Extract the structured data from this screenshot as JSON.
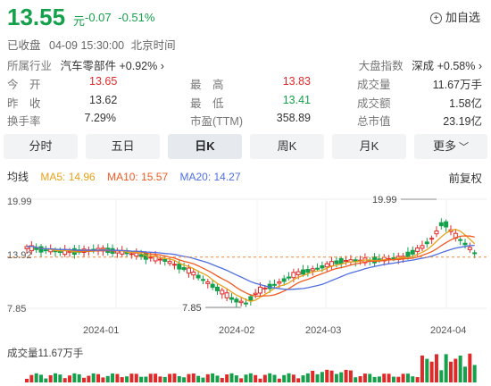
{
  "header": {
    "price": "13.55",
    "unit": "元",
    "change": "-0.07",
    "change_pct": "-0.51%",
    "add_label": "加自选"
  },
  "status": {
    "text": "已收盘",
    "datetime": "04-09 15:30:00",
    "tz": "北京时间"
  },
  "industry": {
    "label": "所属行业",
    "name": "汽车零部件",
    "pct": "+0.92%"
  },
  "index": {
    "label": "大盘指数",
    "name": "深成",
    "pct": "+0.58%"
  },
  "stats": [
    {
      "l1": "今　开",
      "v1": "13.65",
      "l2": "最　高",
      "v2": "13.83",
      "l3": "成交量",
      "v3": "11.67万手"
    },
    {
      "l1": "昨　收",
      "v1": "13.62",
      "l2": "最　低",
      "v2": "13.41",
      "l3": "成交额",
      "v3": "1.58亿"
    },
    {
      "l1": "换手率",
      "v1": "7.29%",
      "l2": "市盈(TTM)",
      "v2": "358.89",
      "l3": "总市值",
      "v3": "23.19亿"
    }
  ],
  "tabs": [
    "分时",
    "五日",
    "日K",
    "周K",
    "月K",
    "更多"
  ],
  "active_tab": "日K",
  "ma": {
    "title": "均线",
    "ma5": "MA5: 14.96",
    "ma10": "MA10: 15.57",
    "ma20": "MA20: 14.27"
  },
  "adjust": "前复权",
  "colors": {
    "up": "#e02a2a",
    "down": "#15a14b",
    "ma5": "#e7a21a",
    "ma10": "#f05a21",
    "ma20": "#4f6fe0"
  },
  "chart_data": {
    "type": "candlestick",
    "y_ticks": [
      "19.99",
      "13.92",
      "7.85"
    ],
    "ylim": [
      7.85,
      19.99
    ],
    "x_ticks": [
      "2024-01",
      "2024-02",
      "2024-03",
      "2024-04"
    ],
    "annotations": [
      {
        "label": "19.99"
      },
      {
        "label": "7.85"
      }
    ],
    "last_close": 13.55,
    "volume_label": "成交量11.67万手"
  }
}
